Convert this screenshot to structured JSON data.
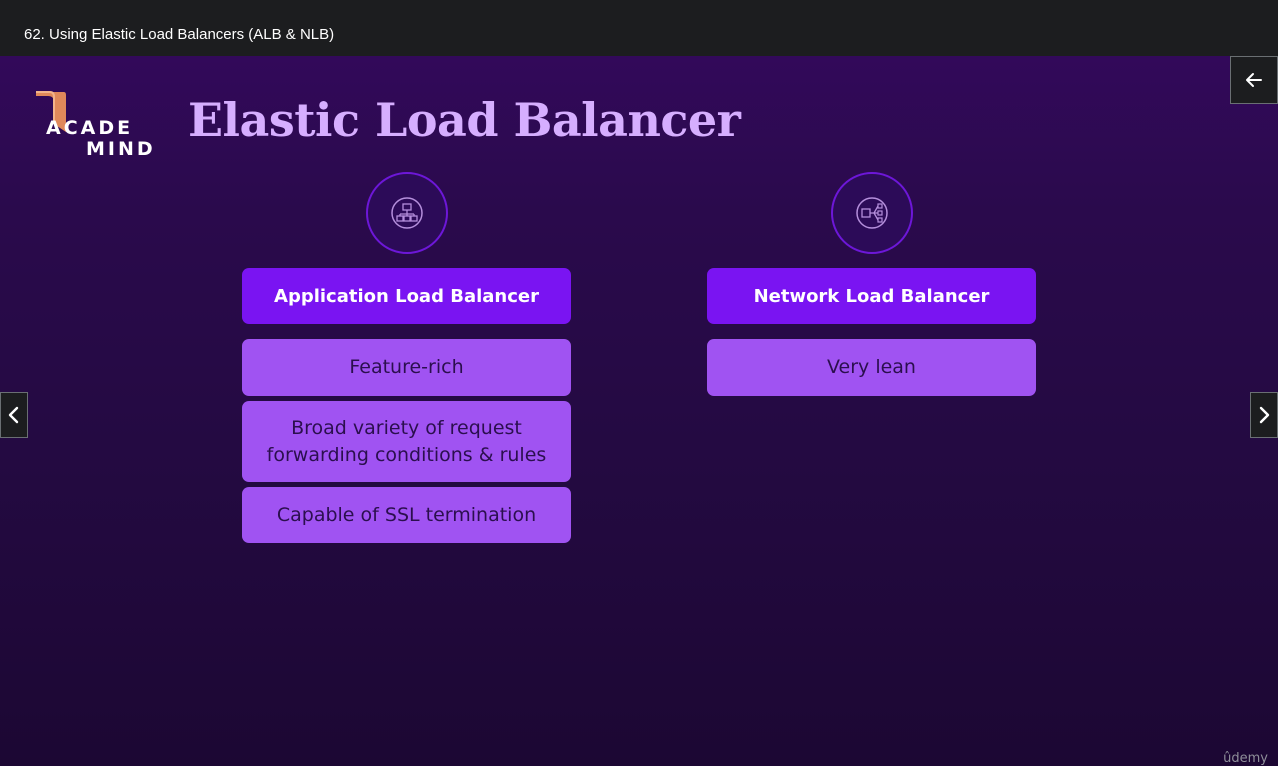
{
  "header": {
    "lecture_title": "62. Using Elastic Load Balancers (ALB & NLB)"
  },
  "slide": {
    "logo": {
      "line1": "ACADE",
      "line2": "MIND"
    },
    "title": "Elastic Load Balancer",
    "columns": [
      {
        "icon": "application-load-balancer-icon",
        "heading": "Application Load Balancer",
        "features": [
          "Feature-rich",
          "Broad variety of request forwarding conditions & rules",
          "Capable of SSL termination"
        ]
      },
      {
        "icon": "network-load-balancer-icon",
        "heading": "Network Load Balancer",
        "features": [
          "Very lean"
        ]
      }
    ]
  },
  "controls": {
    "back_icon": "arrow-left-icon",
    "prev_icon": "chevron-left-icon",
    "next_icon": "chevron-right-icon"
  },
  "watermark": "ûdemy",
  "colors": {
    "topbar": "#1c1d1f",
    "slide_bg": "#2a0a4c",
    "title": "#d6aeff",
    "heading_box": "#7a14f2",
    "feature_box": "#a053f2",
    "logo_accent": "#e0895a"
  }
}
